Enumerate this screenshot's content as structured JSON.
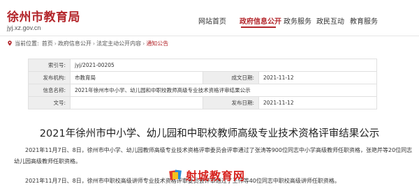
{
  "header": {
    "site_title": "徐州市教育局",
    "site_url": "jyj.xz.gov.cn",
    "nav": [
      {
        "label": "网站首页"
      },
      {
        "label": "政府信息公开"
      },
      {
        "label": "政务服务"
      },
      {
        "label": "政民互动"
      },
      {
        "label": "教育服务"
      }
    ]
  },
  "breadcrumb": {
    "prefix": "当前位置:",
    "items": [
      "首页",
      "政府信息公开",
      "法定主动公开内容",
      "通知公告"
    ]
  },
  "info": {
    "index_label": "索引号:",
    "index_value": "jyj/2021-00205",
    "publisher_label": "发布机构:",
    "publisher_value": "市教育局",
    "created_label": "成文日期:",
    "created_value": "2021-11-12",
    "name_label": "信息名称:",
    "name_value": "2021年徐州市中小学、幼儿园和中职校教师高级专业技术资格评审结果公示",
    "doc_label": "文号:",
    "doc_value": "",
    "published_label": "发布日期:",
    "published_value": "2021-11-12"
  },
  "article": {
    "title": "2021年徐州市中小学、幼儿园和中职校教师高级专业技术资格评审结果公示",
    "paragraph1": "2021年11月7日、8日，徐州市中小学、幼儿园教师高级专业技术资格评审委员会评审通过了张涛等900位同志中小学高级教师任职资格，张艳芹等20位同志幼儿园高级教师任职资格。",
    "paragraph2": "2021年11月7日、8日，徐州市中职校高级讲师专业技术资格评审委员会评审通过了王伟等40位同志中职校高级讲师任职资格。"
  },
  "watermark": {
    "text": "射城教育网"
  }
}
